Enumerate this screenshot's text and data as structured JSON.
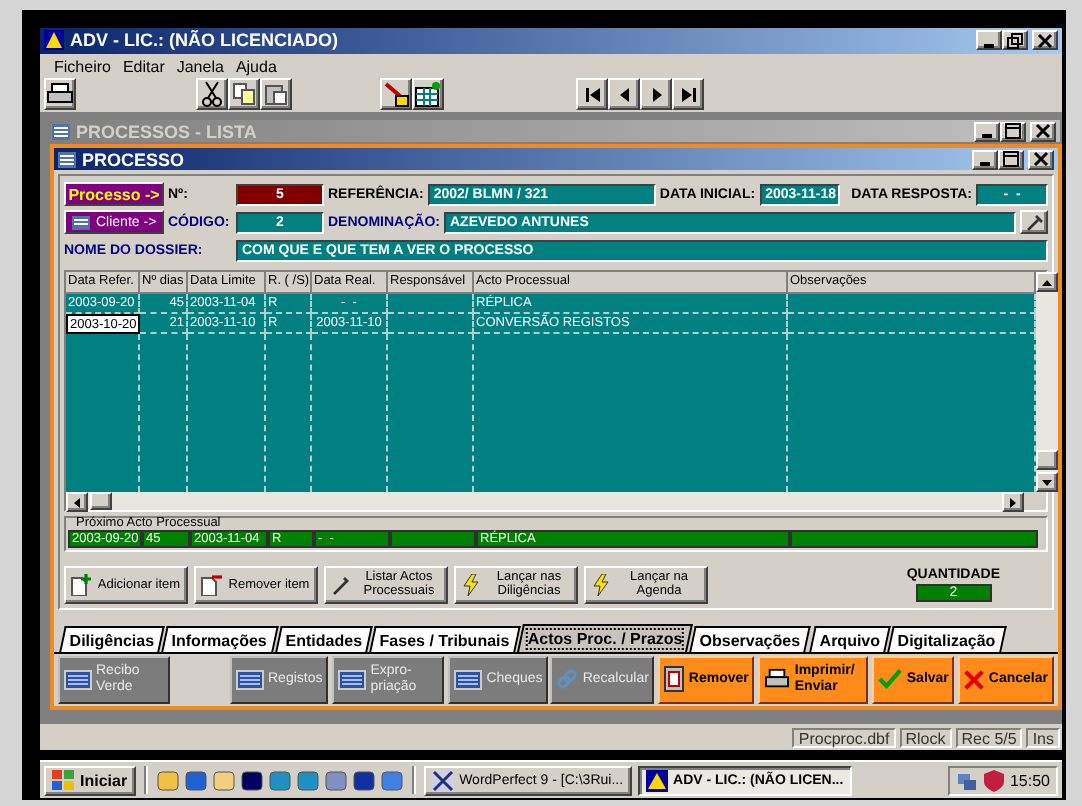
{
  "window": {
    "title": "ADV - LIC.: (NÃO LICENCIADO)"
  },
  "menu": [
    "Ficheiro",
    "Editar",
    "Janela",
    "Ajuda"
  ],
  "list_window": {
    "title": "PROCESSOS - LISTA",
    "active": false
  },
  "form_window": {
    "title": "PROCESSO",
    "active": true
  },
  "header": {
    "processo_button": "Processo ->",
    "numero_label": "Nº:",
    "numero": "5",
    "referencia_label": "REFERÊNCIA:",
    "referencia": "2002/ BLMN / 321",
    "data_inicial_label": "DATA INICIAL:",
    "data_inicial": "2003-11-18",
    "data_resposta_label": "DATA RESPOSTA:",
    "data_resposta": "-  -",
    "cliente_button": "Cliente ->",
    "codigo_label": "CÓDIGO:",
    "codigo": "2",
    "denominacao_label": "DENOMINAÇÃO:",
    "denominacao": "AZEVEDO ANTUNES",
    "dossier_label": "NOME DO DOSSIER:",
    "dossier": "COM QUE E QUE TEM A VER O PROCESSO"
  },
  "table": {
    "columns": [
      "Data Refer.",
      "Nº dias",
      "Data Limite",
      "R. ( /S)",
      "Data Real.",
      "Responsável",
      "Acto Processual",
      "Observações"
    ],
    "rows": [
      {
        "cells": [
          "2003-09-20",
          "45",
          "2003-11-04",
          "R",
          "-  -",
          null,
          "RÉPLICA",
          null
        ],
        "editing": false
      },
      {
        "cells": [
          "2003-10-20",
          "21",
          "2003-11-10",
          "R",
          "2003-11-10",
          null,
          "CONVERSÃO REGISTOS",
          null
        ],
        "editing": true
      }
    ]
  },
  "next_act": {
    "label": "Próximo Acto Processual",
    "cells": [
      "2003-09-20",
      "45",
      "2003-11-04",
      "R",
      "-  -",
      null,
      "RÉPLICA",
      null
    ]
  },
  "actions": [
    "Adicionar item",
    "Remover item",
    "Listar Actos Processuais",
    "Lançar nas Diligências",
    "Lançar na Agenda"
  ],
  "quantity": {
    "label": "QUANTIDADE",
    "value": "2"
  },
  "tabs": [
    {
      "label": "Diligências",
      "selected": false
    },
    {
      "label": "Informações",
      "selected": false
    },
    {
      "label": "Entidades",
      "selected": false
    },
    {
      "label": "Fases / Tribunais",
      "selected": false
    },
    {
      "label": "Actos Proc. / Prazos",
      "selected": true
    },
    {
      "label": "Observações",
      "selected": false
    },
    {
      "label": "Arquivo",
      "selected": false
    },
    {
      "label": "Digitalização",
      "selected": false
    }
  ],
  "button_groups": [
    [
      {
        "label": "Recibo Verde",
        "kind": "neutral"
      }
    ],
    [
      {
        "label": "Registos",
        "kind": "neutral"
      },
      {
        "label": "Expro-priação",
        "kind": "neutral"
      },
      {
        "label": "Cheques",
        "kind": "neutral"
      }
    ],
    [
      {
        "label": "Recalcular",
        "kind": "neutral"
      },
      {
        "label": "Remover",
        "kind": "accent"
      },
      {
        "label": "Imprimir/ Enviar",
        "kind": "accent"
      },
      {
        "label": "Salvar",
        "kind": "accent"
      },
      {
        "label": "Cancelar",
        "kind": "accent"
      }
    ]
  ],
  "status_bar": [
    "Procproc.dbf",
    "Rlock",
    "Rec 5/5",
    "Ins"
  ],
  "taskbar": {
    "start": "Iniciar",
    "tasks": [
      {
        "label": "WordPerfect 9 - [C:\\3Rui...",
        "selected": false
      },
      {
        "label": "ADV - LIC.: (NÃO LICEN...",
        "selected": true
      }
    ],
    "clock": "15:50"
  }
}
